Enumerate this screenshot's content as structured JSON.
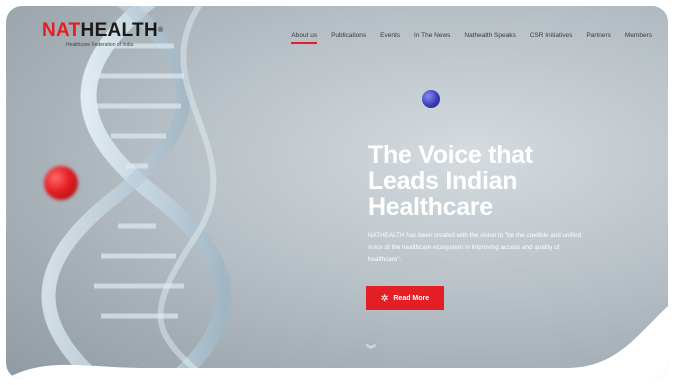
{
  "brand": {
    "name_part1": "NAT",
    "name_part2": "HEALTH",
    "registered": "®",
    "tagline": "Healthcare Federation of India"
  },
  "nav": {
    "items": [
      {
        "label": "About us",
        "active": true
      },
      {
        "label": "Publications"
      },
      {
        "label": "Events"
      },
      {
        "label": "In The News"
      },
      {
        "label": "Nathealth Speaks"
      },
      {
        "label": "CSR Initiatives"
      },
      {
        "label": "Partners"
      },
      {
        "label": "Members"
      }
    ]
  },
  "hero": {
    "title_line1": "The Voice that",
    "title_line2": "Leads Indian",
    "title_line3": "Healthcare",
    "description": "NATHEALTH has been created with the vision to \"be the credible and unified voice of the healthcare ecosystem in improving access and quality of healthcare\".",
    "button_label": "Read More",
    "button_icon": "sparkle-icon",
    "scroll_icon": "double-chevron-down-icon"
  },
  "colors": {
    "accent": "#e31e24",
    "text_dark": "#1a1a1a"
  }
}
